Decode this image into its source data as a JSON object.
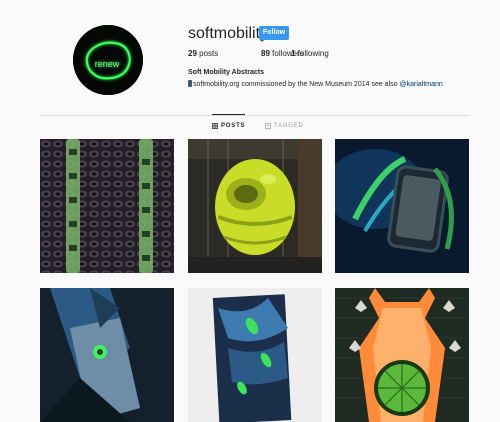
{
  "profile": {
    "username": "softmobility",
    "follow_label": "Follow",
    "avatar_text": "renew"
  },
  "stats": {
    "posts_count": "29",
    "posts_label": "posts",
    "followers_count": "89",
    "followers_label": "followers",
    "following_count": "1",
    "following_label": "following"
  },
  "bio": {
    "name": "Soft Mobility Abstracts",
    "text": "softmobility.org commissioned by the New Museum 2014 see also",
    "mention": "@karialtmann"
  },
  "tabs": [
    {
      "label": "POSTS",
      "icon": "grid-icon",
      "active": true
    },
    {
      "label": "TAGGED",
      "icon": "tag-icon",
      "active": false
    }
  ],
  "posts": [
    {
      "name": "post-1"
    },
    {
      "name": "post-2"
    },
    {
      "name": "post-3"
    },
    {
      "name": "post-4"
    },
    {
      "name": "post-5"
    },
    {
      "name": "post-6"
    }
  ],
  "colors": {
    "accent": "#3897f0",
    "link": "#003569",
    "background": "#fafafa",
    "neon_green": "#39ff14"
  }
}
